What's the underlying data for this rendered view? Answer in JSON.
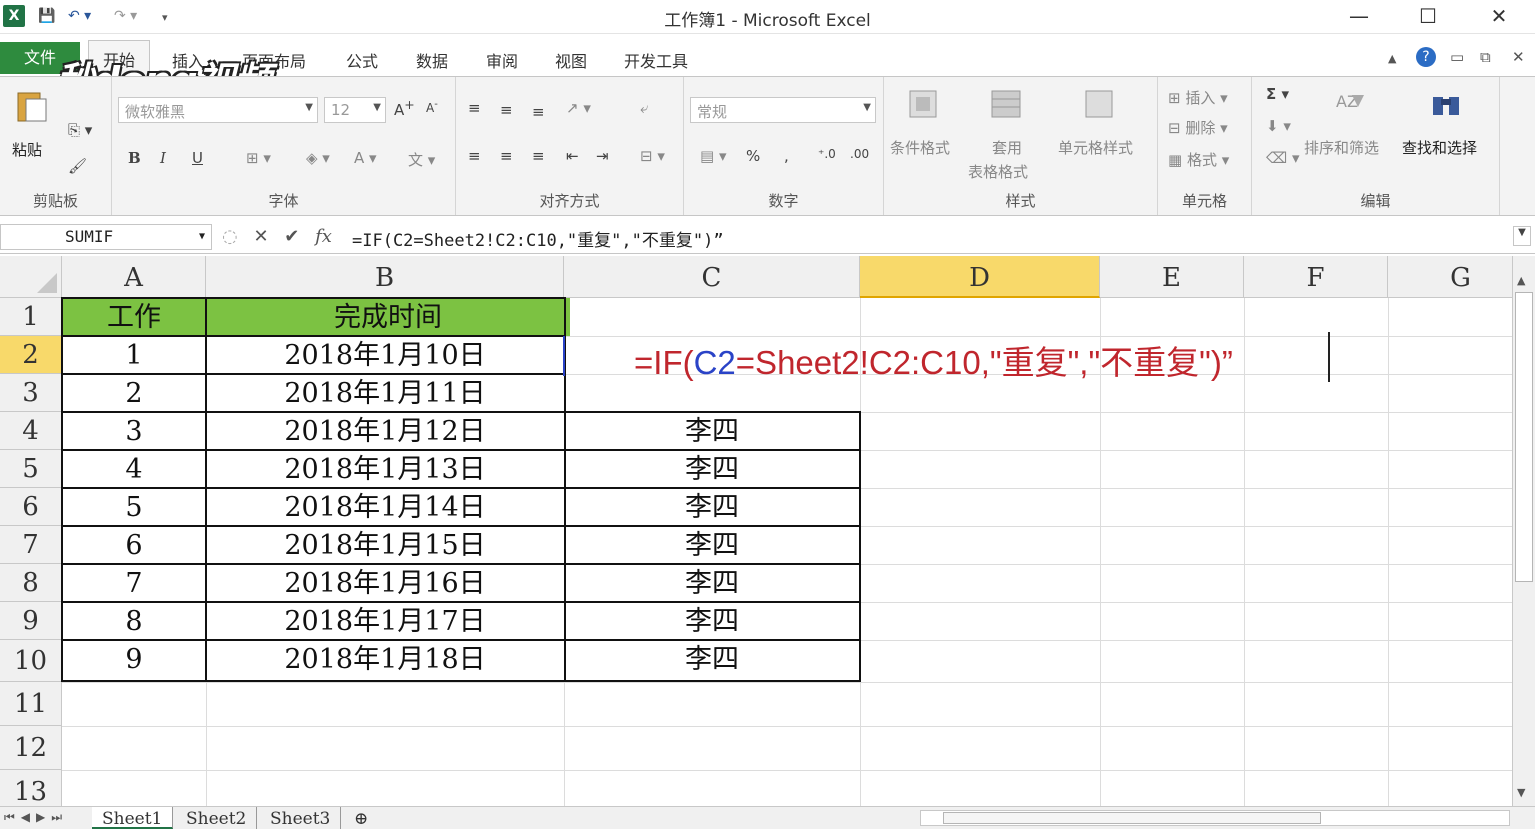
{
  "window": {
    "title": "工作簿1 - Microsoft Excel",
    "app_icon": "excel-icon",
    "minimize": "—",
    "maximize": "☐",
    "close": "✕"
  },
  "watermark": "秒dong视频",
  "tabs": [
    {
      "label": "文件",
      "active": false
    },
    {
      "label": "开始",
      "active": true
    },
    {
      "label": "插入",
      "active": false
    },
    {
      "label": "页面布局",
      "active": false
    },
    {
      "label": "公式",
      "active": false
    },
    {
      "label": "数据",
      "active": false
    },
    {
      "label": "审阅",
      "active": false
    },
    {
      "label": "视图",
      "active": false
    },
    {
      "label": "开发工具",
      "active": false
    }
  ],
  "ribbon": {
    "clipboard": {
      "label": "剪贴板",
      "paste": "粘贴"
    },
    "font": {
      "label": "字体",
      "font_name": "微软雅黑",
      "font_size": "12",
      "bold": "B",
      "italic": "I",
      "underline": "U"
    },
    "alignment": {
      "label": "对齐方式"
    },
    "number": {
      "label": "数字",
      "format": "常规",
      "percent": "%",
      "comma": ","
    },
    "styles": {
      "label": "样式",
      "conditional": "条件格式",
      "table_format_1": "套用",
      "table_format_2": "表格格式",
      "cell_styles": "单元格样式"
    },
    "cells": {
      "label": "单元格",
      "insert": "插入",
      "delete": "删除",
      "format": "格式"
    },
    "editing": {
      "label": "编辑",
      "sum": "Σ",
      "sort_filter": "排序和筛选",
      "find_select": "查找和选择"
    }
  },
  "formula_bar": {
    "name_box": "SUMIF",
    "formula": "=IF(C2=Sheet2!C2:C10,\"重复\",\"不重复\")”"
  },
  "columns": [
    "A",
    "B",
    "C",
    "D",
    "E",
    "F",
    "G"
  ],
  "selected_column": "D",
  "rows": [
    "1",
    "2",
    "3",
    "4",
    "5",
    "6",
    "7",
    "8",
    "9",
    "10",
    "11",
    "12",
    "13"
  ],
  "selected_row": "2",
  "table": {
    "headers": [
      "工作",
      "完成时间"
    ],
    "data": [
      {
        "a": "1",
        "b": "2018年1月10日",
        "c": ""
      },
      {
        "a": "2",
        "b": "2018年1月11日",
        "c": ""
      },
      {
        "a": "3",
        "b": "2018年1月12日",
        "c": "李四"
      },
      {
        "a": "4",
        "b": "2018年1月13日",
        "c": "李四"
      },
      {
        "a": "5",
        "b": "2018年1月14日",
        "c": "李四"
      },
      {
        "a": "6",
        "b": "2018年1月15日",
        "c": "李四"
      },
      {
        "a": "7",
        "b": "2018年1月16日",
        "c": "李四"
      },
      {
        "a": "8",
        "b": "2018年1月17日",
        "c": "李四"
      },
      {
        "a": "9",
        "b": "2018年1月18日",
        "c": "李四"
      }
    ]
  },
  "cell_edit": {
    "prefix": "=IF(",
    "ref": "C2",
    "suffix": "=Sheet2!C2:C10,\"重复\",\"不重复\")”"
  },
  "sheets": [
    {
      "name": "Sheet1",
      "active": true
    },
    {
      "name": "Sheet2",
      "active": false
    },
    {
      "name": "Sheet3",
      "active": false
    }
  ],
  "colors": {
    "header_fill": "#7cc242",
    "file_tab": "#2e8b3e",
    "selection": "#f8d96a",
    "formula_red": "#c0262d",
    "ref_blue": "#2a43c7"
  }
}
